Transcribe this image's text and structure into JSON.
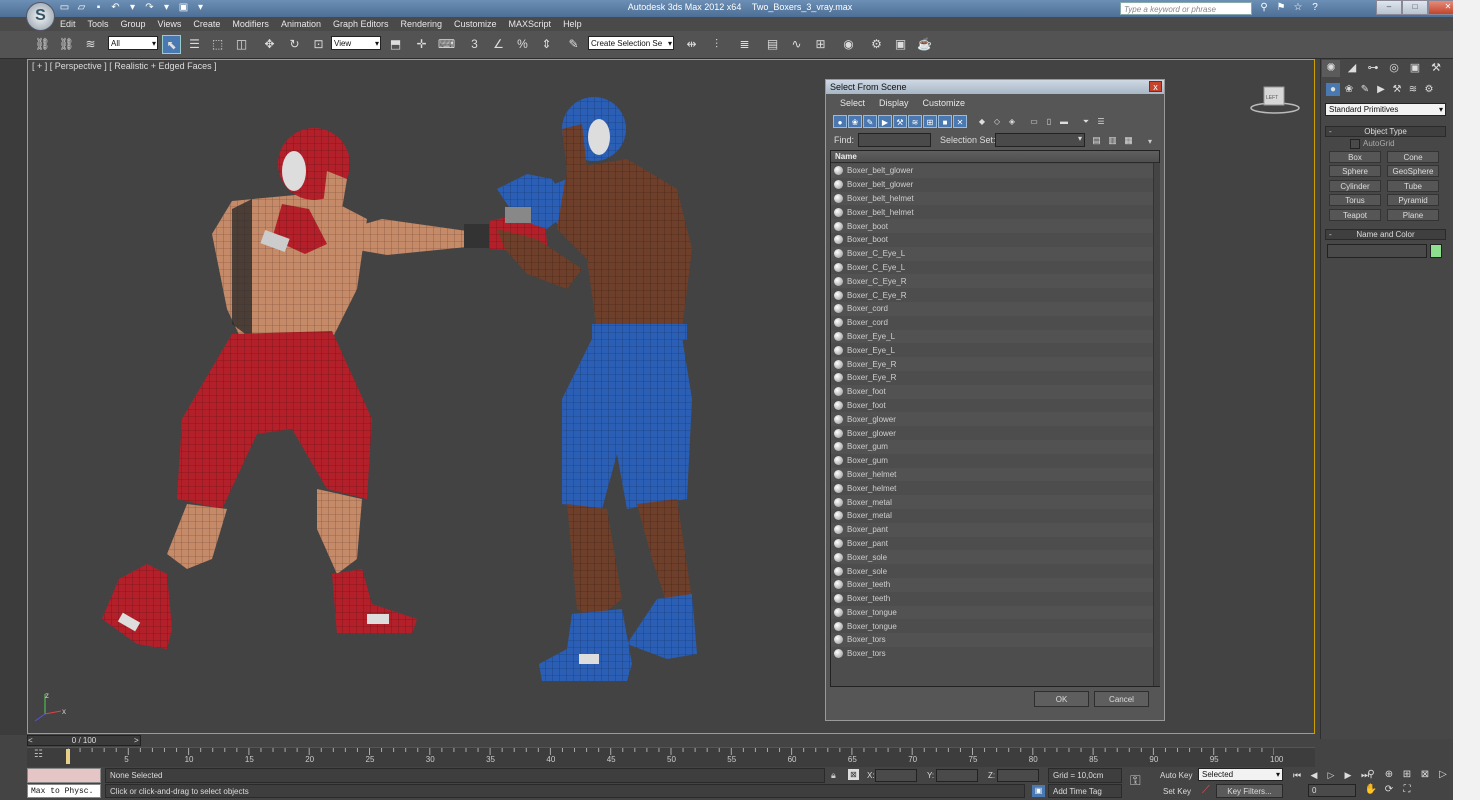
{
  "titlebar": {
    "app": "Autodesk 3ds Max  2012 x64",
    "file": "Two_Boxers_3_vray.max",
    "search_placeholder": "Type a keyword or phrase"
  },
  "menu": [
    "Edit",
    "Tools",
    "Group",
    "Views",
    "Create",
    "Modifiers",
    "Animation",
    "Graph Editors",
    "Rendering",
    "Customize",
    "MAXScript",
    "Help"
  ],
  "toolbar": {
    "filter_value": "All",
    "refcoord_value": "View",
    "named_sel_value": "Create Selection Se",
    "snap_label": "3",
    "percent_label": "%"
  },
  "viewport": {
    "label": "[ + ] [ Perspective ] [ Realistic + Edged Faces ]",
    "viewcube_label": "LEFT",
    "axis_x": "x",
    "axis_y": "y",
    "axis_z": "z"
  },
  "command_panel": {
    "primitive_dropdown": "Standard Primitives",
    "object_type_title": "Object Type",
    "autogrid_label": "AutoGrid",
    "buttons": [
      "Box",
      "Cone",
      "Sphere",
      "GeoSphere",
      "Cylinder",
      "Tube",
      "Torus",
      "Pyramid",
      "Teapot",
      "Plane"
    ],
    "name_color_title": "Name and Color",
    "color": "#8de08d",
    "minus": "-"
  },
  "dialog": {
    "title": "Select From Scene",
    "close": "x",
    "menu": [
      "Select",
      "Display",
      "Customize"
    ],
    "find_label": "Find:",
    "selection_set_label": "Selection Set:",
    "column_name": "Name",
    "items": [
      "Boxer_belt_glower",
      "Boxer_belt_glower",
      "Boxer_belt_helmet",
      "Boxer_belt_helmet",
      "Boxer_boot",
      "Boxer_boot",
      "Boxer_C_Eye_L",
      "Boxer_C_Eye_L",
      "Boxer_C_Eye_R",
      "Boxer_C_Eye_R",
      "Boxer_cord",
      "Boxer_cord",
      "Boxer_Eye_L",
      "Boxer_Eye_L",
      "Boxer_Eye_R",
      "Boxer_Eye_R",
      "Boxer_foot",
      "Boxer_foot",
      "Boxer_glower",
      "Boxer_glower",
      "Boxer_gum",
      "Boxer_gum",
      "Boxer_helmet",
      "Boxer_helmet",
      "Boxer_metal",
      "Boxer_metal",
      "Boxer_pant",
      "Boxer_pant",
      "Boxer_sole",
      "Boxer_sole",
      "Boxer_teeth",
      "Boxer_teeth",
      "Boxer_tongue",
      "Boxer_tongue",
      "Boxer_tors",
      "Boxer_tors"
    ],
    "ok_label": "OK",
    "cancel_label": "Cancel"
  },
  "timeline": {
    "slider_label": "0 / 100",
    "ticks": [
      "5",
      "10",
      "15",
      "20",
      "25",
      "30",
      "35",
      "40",
      "45",
      "50",
      "55",
      "60",
      "65",
      "70",
      "75",
      "80",
      "85",
      "90",
      "95",
      "100"
    ],
    "prev": "<",
    "next": ">"
  },
  "status": {
    "maxscript_text": "Max to Physc.",
    "selection_text": "None Selected",
    "prompt_text": "Click or click-and-drag to select objects",
    "x_label": "X:",
    "y_label": "Y:",
    "z_label": "Z:",
    "grid_text": "Grid = 10,0cm",
    "add_time_tag": "Add Time Tag",
    "auto_key": "Auto Key",
    "set_key": "Set Key",
    "selected_dropdown": "Selected",
    "key_filters": "Key Filters...",
    "frame_value": "0"
  },
  "colors": {
    "red_boxer": "#b3202a",
    "blue_boxer": "#2a5fb5",
    "skin_light": "#c58a68",
    "skin_dark": "#6e3f2a",
    "viewport_border": "#cca000"
  }
}
